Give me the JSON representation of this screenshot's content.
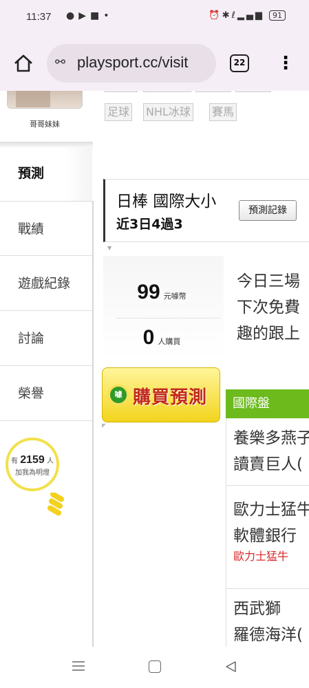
{
  "status_bar": {
    "time": "11:37",
    "left_icons": [
      "chat-icon",
      "youtube-icon",
      "notes-icon",
      "dot-icon"
    ],
    "right_icons": [
      "alarm-icon",
      "bluetooth-icon",
      "volte-icon",
      "signal-icon"
    ],
    "battery": "91"
  },
  "browser": {
    "url": "playsport.cc/visit",
    "tab_count": "22"
  },
  "profile": {
    "nickname": "哥哥妹妹"
  },
  "sport_tags": [
    "足球",
    "NHL冰球",
    "賽馬"
  ],
  "sidebar": {
    "items": [
      {
        "label": "預測"
      },
      {
        "label": "戰績"
      },
      {
        "label": "遊戲紀錄"
      },
      {
        "label": "討論"
      },
      {
        "label": "榮譽"
      }
    ]
  },
  "bulb": {
    "prefix": "有",
    "count": "2159",
    "suffix": "人",
    "caption": "加我為明燈"
  },
  "prediction": {
    "title": "日棒 國際大小",
    "record": "近3日4過3",
    "record_button": "預測記錄",
    "price": "99",
    "price_unit": "元噱幣",
    "buyers": "0",
    "buyers_unit": "人購買",
    "buy_button": "購買預測",
    "buy_icon_text": "噱",
    "description": [
      "今日三場",
      "下次免費",
      "趣的跟上"
    ]
  },
  "games_panel": {
    "header": "國際盤",
    "games": [
      {
        "lines": [
          "養樂多燕子",
          "讀賣巨人("
        ],
        "pick": ""
      },
      {
        "lines": [
          "歐力士猛牛",
          "軟體銀行"
        ],
        "pick": "歐力士猛牛"
      },
      {
        "lines": [
          "西武獅",
          "羅德海洋("
        ],
        "pick": ""
      }
    ]
  },
  "colors": {
    "accent_green": "#6cba1c",
    "buy_yellow": "#f3d41d",
    "buy_red": "#c12a1a",
    "pick_red": "#d8292b"
  }
}
